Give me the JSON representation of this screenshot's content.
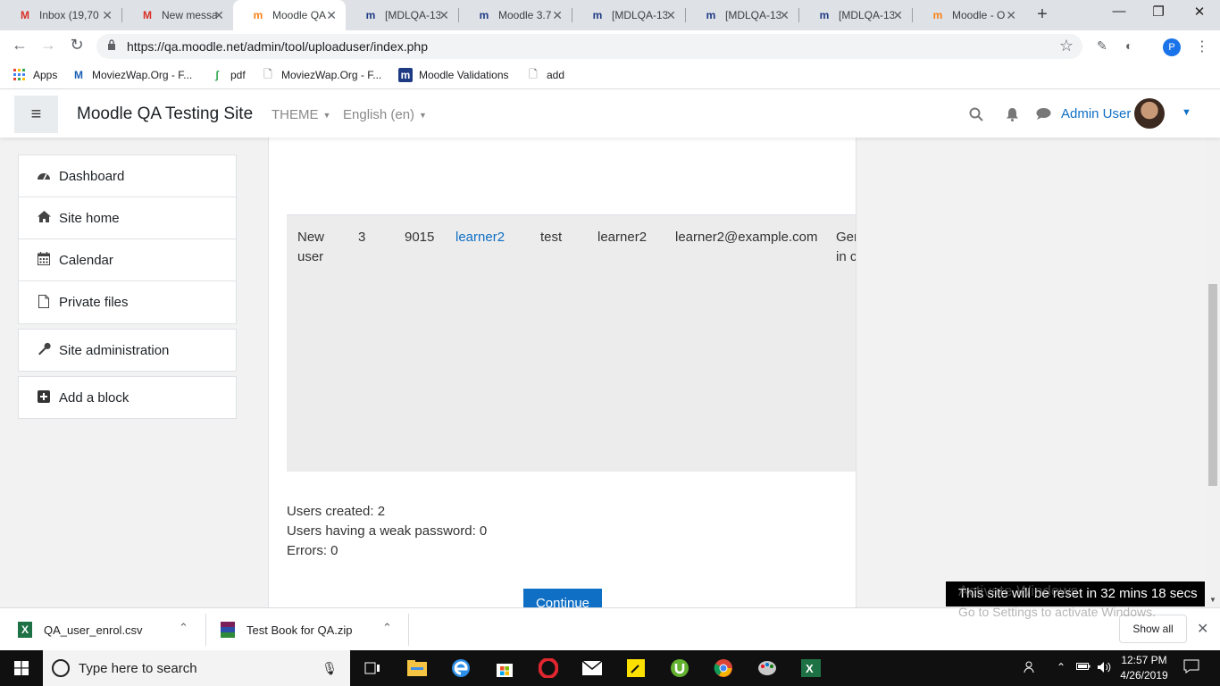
{
  "browser": {
    "tabs": [
      {
        "label": "Inbox (19,70",
        "icon": "M",
        "color": "#d93025"
      },
      {
        "label": "New messa",
        "icon": "M",
        "color": "#d93025"
      },
      {
        "label": "Moodle QA",
        "icon": "m",
        "color": "#f98012",
        "active": true
      },
      {
        "label": "[MDLQA-13",
        "icon": "m",
        "color": "#1f3b84"
      },
      {
        "label": "Moodle 3.7",
        "icon": "m",
        "color": "#1f3b84"
      },
      {
        "label": "[MDLQA-13",
        "icon": "m",
        "color": "#1f3b84"
      },
      {
        "label": "[MDLQA-13",
        "icon": "m",
        "color": "#1f3b84"
      },
      {
        "label": "[MDLQA-13",
        "icon": "m",
        "color": "#1f3b84"
      },
      {
        "label": "Moodle - O",
        "icon": "m",
        "color": "#f98012"
      }
    ],
    "url": "https://qa.moodle.net/admin/tool/uploaduser/index.php",
    "profile_initial": "P",
    "bookmarks": [
      {
        "label": "Apps",
        "icon": "apps-grid"
      },
      {
        "label": "MoviezWap.Org - F...",
        "icon": "moviezwap-icon"
      },
      {
        "label": "pdf",
        "icon": "leaf-icon"
      },
      {
        "label": "MoviezWap.Org - F...",
        "icon": "page-icon"
      },
      {
        "label": "Moodle Validations",
        "icon": "moodle-icon"
      },
      {
        "label": "add",
        "icon": "page-icon"
      }
    ]
  },
  "moodle": {
    "site_name": "Moodle QA Testing Site",
    "theme_menu": "THEME",
    "language_menu": "English (en)",
    "user_name": "Admin User"
  },
  "nav_blocks": {
    "group": [
      {
        "label": "Dashboard",
        "icon": "dashboard-icon"
      },
      {
        "label": "Site home",
        "icon": "home-icon"
      },
      {
        "label": "Calendar",
        "icon": "calendar-icon"
      },
      {
        "label": "Private files",
        "icon": "file-icon"
      }
    ],
    "site_admin": "Site administration",
    "add_block": "Add a block"
  },
  "upload_table": {
    "row": [
      "New user",
      "3",
      "9015",
      "learner2",
      "test",
      "learner2",
      "learner2@example.com",
      "General in c"
    ]
  },
  "summary": {
    "users_created": "Users created: 2",
    "weak_password": "Users having a weak password: 0",
    "errors": "Errors: 0"
  },
  "continue_label": "Continue",
  "reset_notice": "This site will be reset in 32 mins 18 secs",
  "windows_watermark": {
    "line1": "Activate Windows",
    "line2": "Go to Settings to activate Windows."
  },
  "downloads": [
    {
      "label": "QA_user_enrol.csv",
      "icon": "excel-csv-icon"
    },
    {
      "label": "Test Book for QA.zip",
      "icon": "winrar-icon"
    }
  ],
  "show_all": "Show all",
  "taskbar": {
    "search_placeholder": "Type here to search",
    "time": "12:57 PM",
    "date": "4/26/2019"
  }
}
